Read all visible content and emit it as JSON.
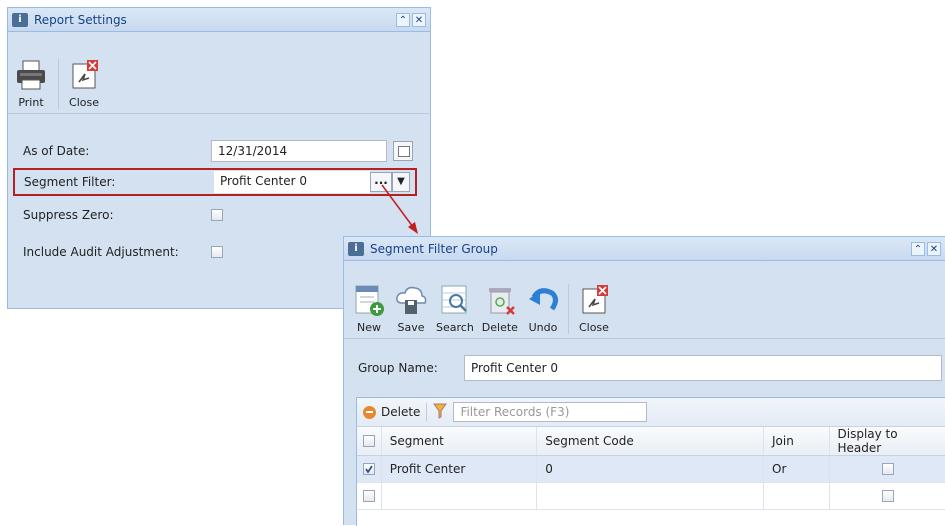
{
  "report_settings": {
    "title": "Report Settings",
    "toolbar": {
      "print_label": "Print",
      "close_label": "Close"
    },
    "fields": {
      "as_of_date_label": "As of Date:",
      "as_of_date_value": "12/31/2014",
      "segment_filter_label": "Segment Filter:",
      "segment_filter_value": "Profit Center 0",
      "segment_filter_ellipsis": "...",
      "suppress_zero_label": "Suppress Zero:",
      "include_audit_label": "Include Audit Adjustment:"
    }
  },
  "segment_filter_group": {
    "title": "Segment Filter Group",
    "toolbar": {
      "new_label": "New",
      "save_label": "Save",
      "search_label": "Search",
      "delete_label": "Delete",
      "undo_label": "Undo",
      "close_label": "Close"
    },
    "group_name_label": "Group Name:",
    "group_name_value": "Profit Center 0",
    "grid_toolbar": {
      "delete_label": "Delete",
      "filter_placeholder": "Filter Records (F3)"
    },
    "columns": [
      "Segment",
      "Segment Code",
      "Join",
      "Display to Header"
    ],
    "rows": [
      {
        "segment": "Profit Center",
        "code": "0",
        "join": "Or",
        "selected": true,
        "display_to_header": false
      },
      {
        "segment": "",
        "code": "",
        "join": "",
        "selected": false,
        "display_to_header": false
      }
    ]
  },
  "colors": {
    "window_bg": "#d3e1f1",
    "title_text": "#15428b",
    "highlight_border": "#b22222"
  }
}
